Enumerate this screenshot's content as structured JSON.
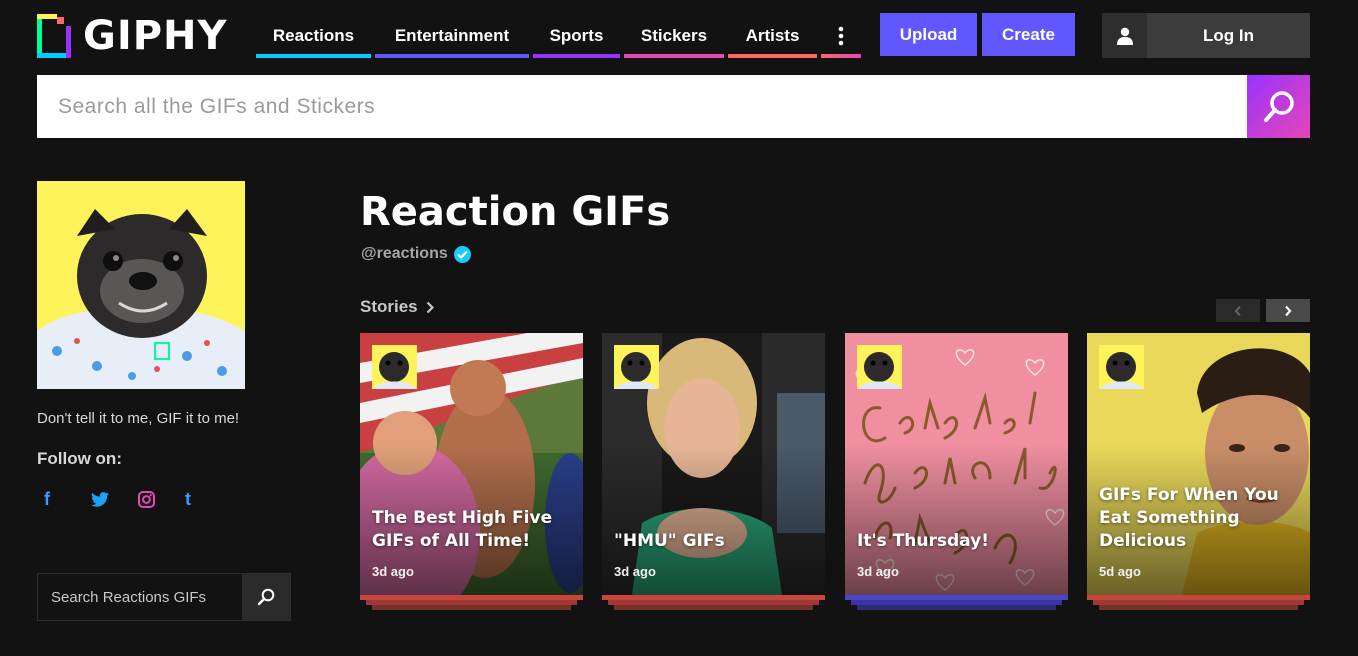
{
  "logo": {
    "text": "GIPHY"
  },
  "nav": {
    "items": [
      {
        "label": "Reactions",
        "color": "#00ccff",
        "width": 115
      },
      {
        "label": "Entertainment",
        "color": "#6157ff",
        "width": 154
      },
      {
        "label": "Sports",
        "color": "#9933ff",
        "width": 87
      },
      {
        "label": "Stickers",
        "color": "#e646b6",
        "width": 100
      },
      {
        "label": "Artists",
        "color": "#ff6666",
        "width": 89
      }
    ],
    "more_icon": "more-vertical-icon",
    "upload_label": "Upload",
    "create_label": "Create",
    "login_label": "Log In"
  },
  "search": {
    "placeholder": "Search all the GIFs and Stickers",
    "icon": "search-icon"
  },
  "channel": {
    "tagline": "Don't tell it to me, GIF it to me!",
    "follow_label": "Follow on:",
    "socials": [
      {
        "name": "facebook-icon",
        "glyph": "f",
        "color": "#3b9bff"
      },
      {
        "name": "twitter-icon",
        "glyph": "",
        "color": "#1da1f2"
      },
      {
        "name": "instagram-icon",
        "glyph": "",
        "color": "#e646b6"
      },
      {
        "name": "tumblr-icon",
        "glyph": "t",
        "color": "#3b9bff"
      }
    ],
    "search_placeholder": "Search Reactions GIFs",
    "title": "Reaction GIFs",
    "handle": "@reactions",
    "verified_icon": "verified-check-icon",
    "stories_label": "Stories"
  },
  "stories": [
    {
      "title": "The Best High Five GIFs of All Time!",
      "time": "3d ago",
      "accent": "#c8453d"
    },
    {
      "title": "\"HMU\" GIFs",
      "time": "3d ago",
      "accent": "#c8453d"
    },
    {
      "title": "It's Thursday!",
      "time": "3d ago",
      "accent": "#4b45c8"
    },
    {
      "title": "GIFs For When You Eat Something Delicious",
      "time": "5d ago",
      "accent": "#c8453d"
    }
  ],
  "colors": {
    "background": "#121212",
    "primary_button": "#6157ff",
    "search_gradient": [
      "#9933ff",
      "#e646b6"
    ],
    "verified": "#15cdff",
    "avatar_bg": "#fff35c"
  }
}
